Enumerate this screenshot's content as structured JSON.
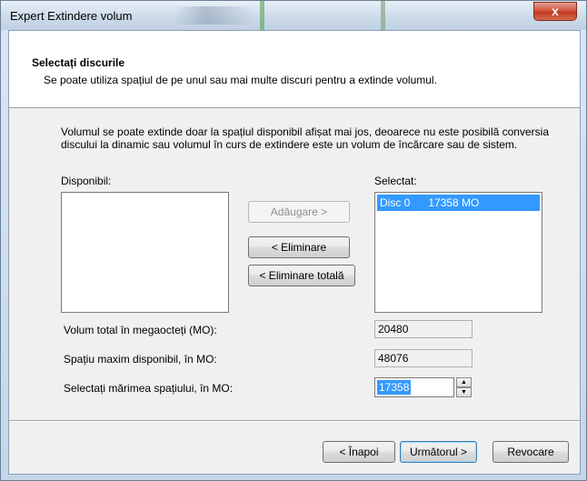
{
  "window": {
    "title": "Expert Extindere volum",
    "close_glyph": "x"
  },
  "header": {
    "title": "Selectați discurile",
    "subtitle": "Se poate utiliza spațiul de pe unul sau mai multe discuri pentru a extinde volumul."
  },
  "info_text": "Volumul se poate extinde doar la spațiul disponibil afișat mai jos, deoarece nu este posibilă conversia discului la dinamic sau volumul în curs de extindere este un volum de încărcare sau de sistem.",
  "available": {
    "label": "Disponibil:",
    "items": []
  },
  "selected": {
    "label": "Selectat:",
    "items": [
      {
        "text": "Disc 0      17358 MO"
      }
    ]
  },
  "buttons": {
    "add": "Adăugare >",
    "remove": "< Eliminare",
    "remove_all": "< Eliminare totală",
    "back": "< Înapoi",
    "next": "Următorul >",
    "cancel": "Revocare"
  },
  "fields": {
    "total_label": "Volum total în megaocteți (MO):",
    "total_value": "20480",
    "max_label": "Spațiu maxim disponibil, în MO:",
    "max_value": "48076",
    "select_label": "Selectați mărimea spațiului, în MO:",
    "select_value": "17358"
  },
  "icons": {
    "spin_up": "up-arrow-icon",
    "spin_down": "down-arrow-icon"
  }
}
